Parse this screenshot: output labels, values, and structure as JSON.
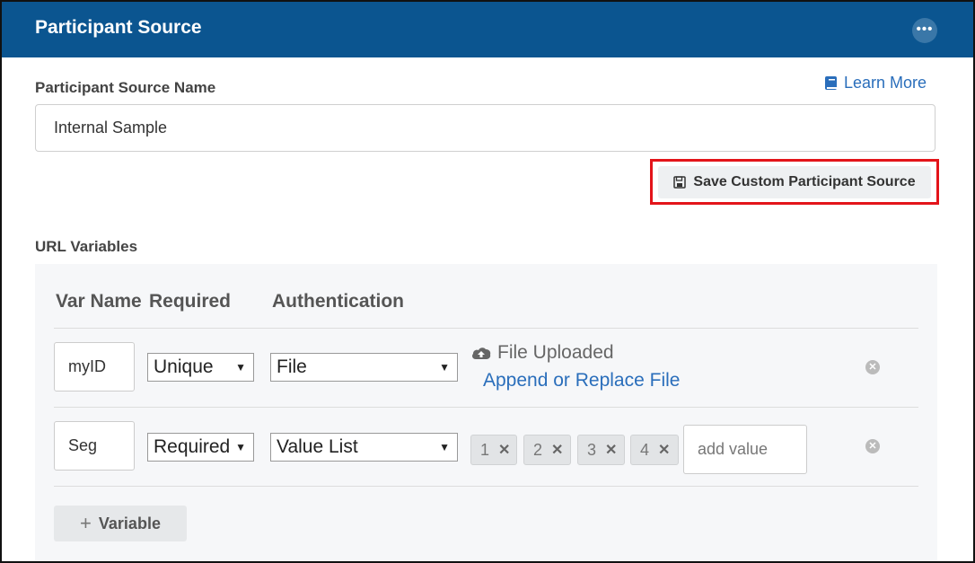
{
  "header": {
    "title": "Participant Source",
    "more_icon": "ellipsis-icon"
  },
  "form": {
    "name_label": "Participant Source Name",
    "learn_more": "Learn More",
    "name_value": "Internal Sample",
    "save_label": "Save Custom Participant Source",
    "url_variables_label": "URL Variables"
  },
  "table": {
    "columns": {
      "var_name": "Var Name",
      "required": "Required",
      "authentication": "Authentication"
    },
    "rows": [
      {
        "var_name": "myID",
        "required": "Unique",
        "authentication": "File",
        "status": "File Uploaded",
        "action": "Append or Replace File"
      },
      {
        "var_name": "Seg",
        "required": "Required",
        "authentication": "Value List",
        "values": [
          "1",
          "2",
          "3",
          "4"
        ],
        "add_placeholder": "add value"
      }
    ],
    "add_variable": "Variable"
  },
  "colors": {
    "header_bg": "#0b5590",
    "link": "#2a6ebb",
    "highlight": "#e3141a"
  }
}
